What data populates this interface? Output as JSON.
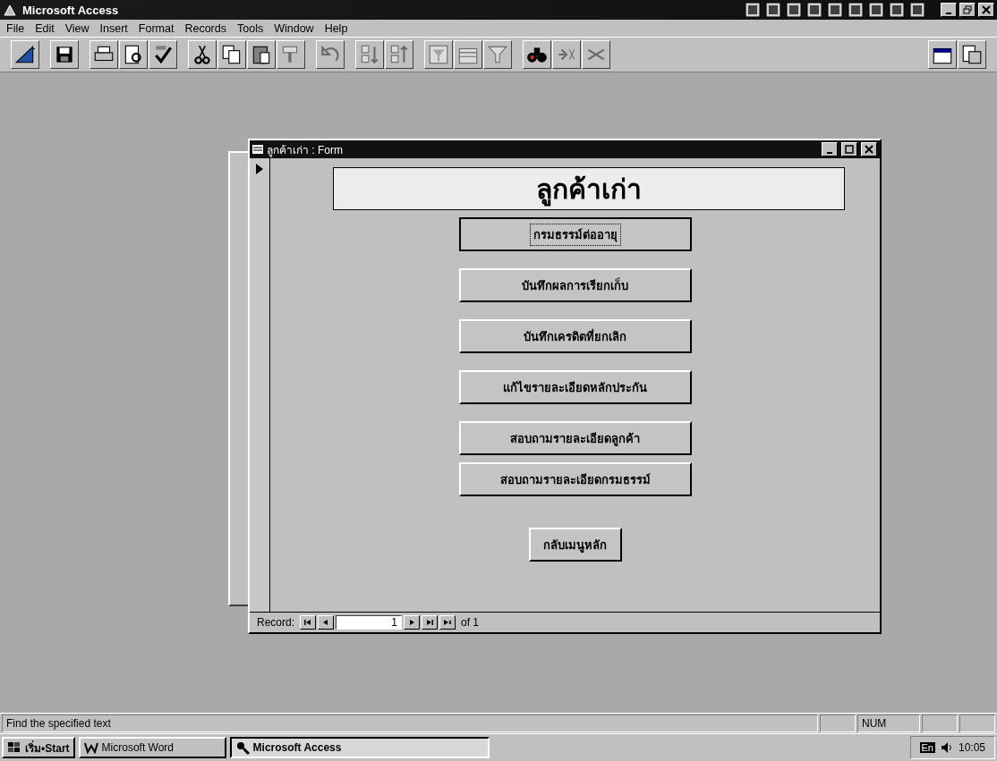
{
  "window": {
    "title": "Microsoft Access"
  },
  "menu": [
    "File",
    "Edit",
    "View",
    "Insert",
    "Format",
    "Records",
    "Tools",
    "Window",
    "Help"
  ],
  "form": {
    "title": "ลูกค้าเก่า : Form",
    "heading": "ลูกค้าเก่า",
    "buttons": [
      {
        "label": "กรมธรรม์ต่ออายุ",
        "focused": true,
        "kind": "wide"
      },
      {
        "label": "บันทึกผลการเรียกเก็บ",
        "focused": false,
        "kind": "wide"
      },
      {
        "label": "บันทึกเครดิตที่ยกเลิก",
        "focused": false,
        "kind": "wide"
      },
      {
        "label": "แก้ไขรายละเอียดหลักประกัน",
        "focused": false,
        "kind": "wide"
      },
      {
        "label": "สอบถามรายละเอียดลูกค้า",
        "focused": false,
        "kind": "wide"
      },
      {
        "label": "สอบถามรายละเอียดกรมธรรม์",
        "focused": false,
        "kind": "wide"
      },
      {
        "label": "กลับเมนูหลัก",
        "focused": false,
        "kind": "narrow"
      }
    ],
    "record_nav": {
      "label": "Record:",
      "current": "1",
      "total": "of 1"
    }
  },
  "status_bar": {
    "text": "Find the specified text",
    "indicator": "NUM"
  },
  "taskbar": {
    "start": "เริ่ม•Start",
    "tasks": [
      {
        "label": "Microsoft Word",
        "selected": false
      },
      {
        "label": "Microsoft Access",
        "selected": true
      }
    ],
    "language": "En",
    "clock": "10:05"
  }
}
